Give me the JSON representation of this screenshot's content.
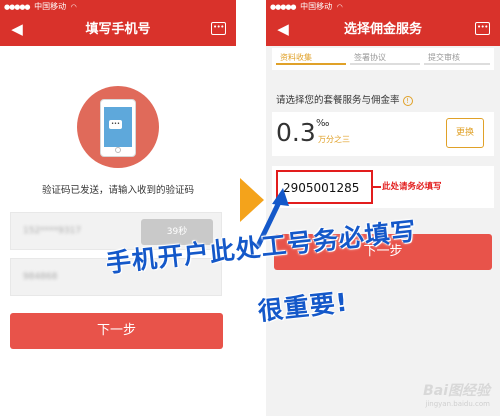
{
  "left_screen": {
    "status_carrier": "中国移动",
    "title": "填写手机号",
    "back_icon": "arrow-left-icon",
    "chat_icon": "chat-bubble-icon",
    "chat_glyph": "•••",
    "phone_bubble": "•••",
    "code_sent_text": "验证码已发送，请输入收到的验证码",
    "phone_field_value": "152****9317",
    "countdown_label": "39秒",
    "code_field_value": "984868",
    "next_button": "下一步"
  },
  "right_screen": {
    "status_carrier": "中国移动",
    "title": "选择佣金服务",
    "back_icon": "arrow-left-icon",
    "chat_icon": "chat-bubble-icon",
    "chat_glyph": "•••",
    "tabs": [
      {
        "label": "资料收集",
        "active": true
      },
      {
        "label": "签署协议",
        "active": false
      },
      {
        "label": "提交审核",
        "active": false
      }
    ],
    "prompt": "请选择您的套餐服务与佣金率",
    "info_glyph": "!",
    "rate_value": "0.3",
    "rate_symbol": "‰",
    "rate_unit": "万分之三",
    "change_button": "更换",
    "employee_number": "2905001285",
    "employee_note": "此处请务必填写",
    "next_button": "下一步"
  },
  "annotation": {
    "line1": "手机开户此处工号务必填写",
    "line2": "很重要!"
  },
  "watermark": {
    "text": "Bai图经验",
    "sub": "jingyan.baidu.com"
  },
  "colors": {
    "brand_red": "#d9322b",
    "button_red": "#e8534a",
    "accent_orange": "#e0a128",
    "highlight_red": "#e21d1d",
    "annotation_blue": "#1458c9"
  }
}
